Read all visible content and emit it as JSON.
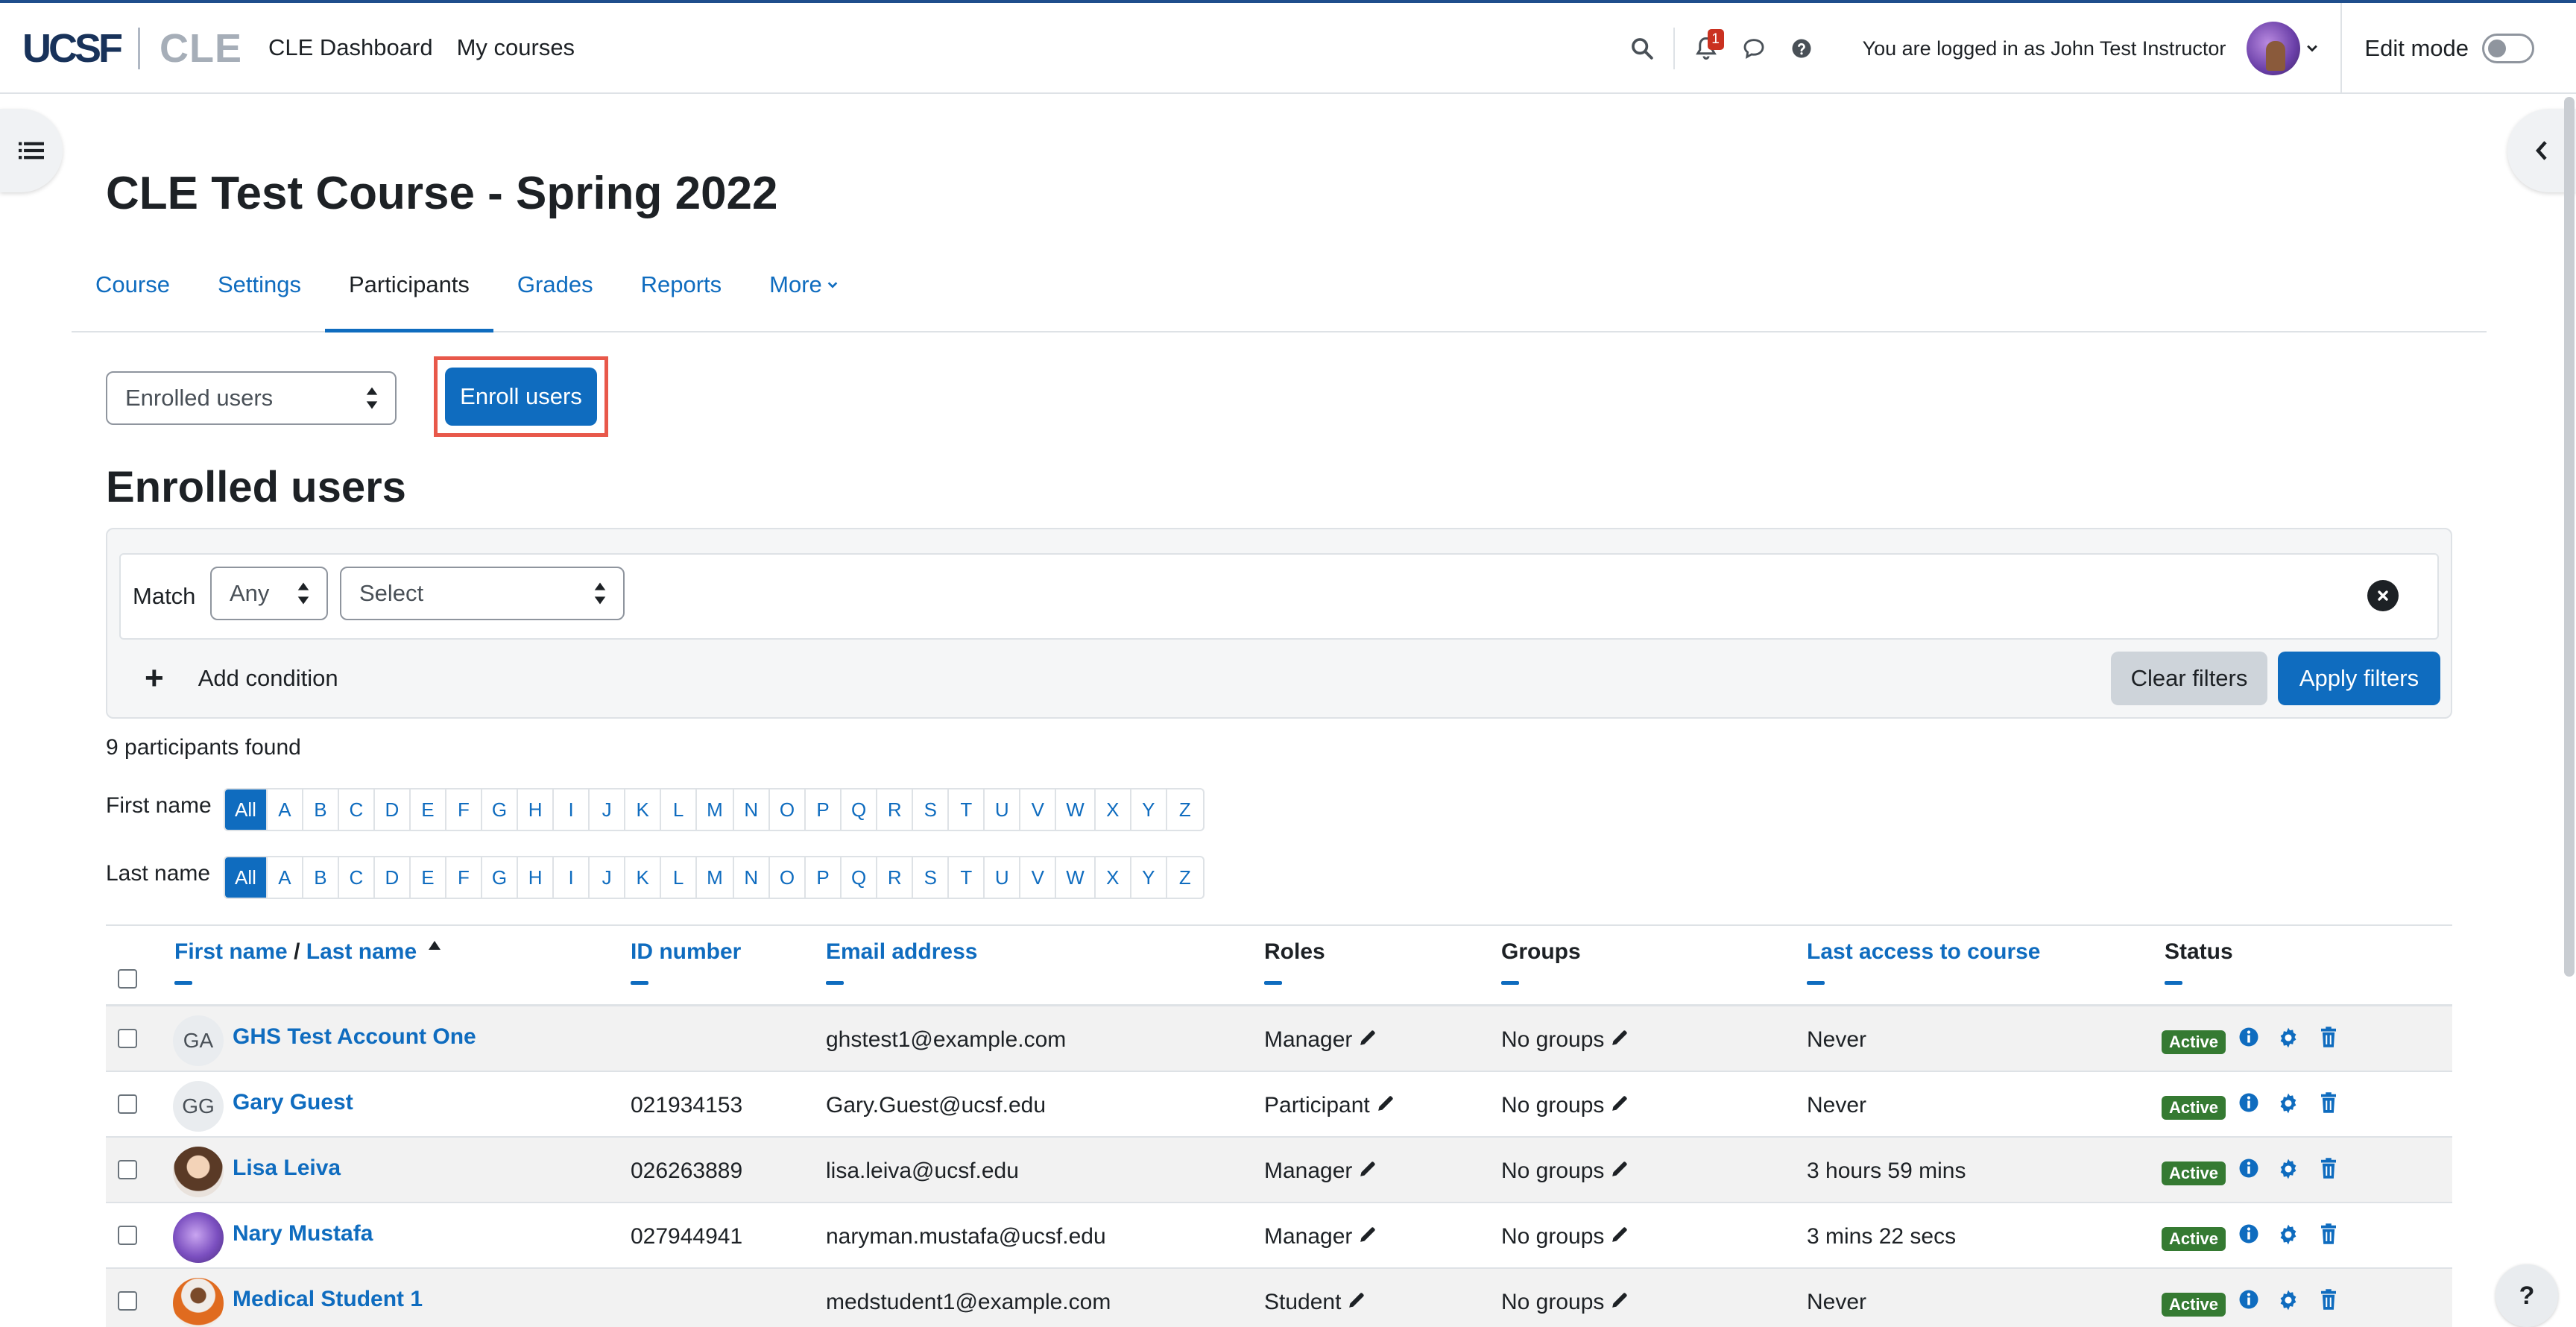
{
  "brand": {
    "logo_primary": "UCSF",
    "logo_secondary": "CLE"
  },
  "nav": {
    "links": [
      "CLE Dashboard",
      "My courses"
    ]
  },
  "header": {
    "notification_count": "1",
    "logged_in_text": "You are logged in as John Test Instructor",
    "edit_mode_label": "Edit mode"
  },
  "course": {
    "title": "CLE Test Course - Spring 2022",
    "tabs": [
      "Course",
      "Settings",
      "Participants",
      "Grades",
      "Reports",
      "More"
    ],
    "active_tab": "Participants"
  },
  "actions": {
    "view_select_value": "Enrolled users",
    "enroll_button": "Enroll users"
  },
  "section_title": "Enrolled users",
  "filters": {
    "match_label": "Match",
    "match_value": "Any",
    "select_value": "Select",
    "add_condition": "Add condition",
    "clear_button": "Clear filters",
    "apply_button": "Apply filters"
  },
  "participants_count_text": "9 participants found",
  "initials": {
    "first_label": "First name",
    "last_label": "Last name",
    "letters": [
      "All",
      "A",
      "B",
      "C",
      "D",
      "E",
      "F",
      "G",
      "H",
      "I",
      "J",
      "K",
      "L",
      "M",
      "N",
      "O",
      "P",
      "Q",
      "R",
      "S",
      "T",
      "U",
      "V",
      "W",
      "X",
      "Y",
      "Z"
    ]
  },
  "table": {
    "headers": {
      "first_name": "First name",
      "slash": "/",
      "last_name": "Last name",
      "id_number": "ID number",
      "email": "Email address",
      "roles": "Roles",
      "groups": "Groups",
      "last_access": "Last access to course",
      "status": "Status"
    },
    "rows": [
      {
        "initials": "GA",
        "name": "GHS Test Account One",
        "id": "",
        "email": "ghstest1@example.com",
        "role": "Manager",
        "groups": "No groups",
        "last_access": "Never",
        "status": "Active"
      },
      {
        "initials": "GG",
        "name": "Gary Guest",
        "id": "021934153",
        "email": "Gary.Guest@ucsf.edu",
        "role": "Participant",
        "groups": "No groups",
        "last_access": "Never",
        "status": "Active"
      },
      {
        "initials": "",
        "name": "Lisa Leiva",
        "id": "026263889",
        "email": "lisa.leiva@ucsf.edu",
        "role": "Manager",
        "groups": "No groups",
        "last_access": "3 hours 59 mins",
        "status": "Active"
      },
      {
        "initials": "",
        "name": "Nary Mustafa",
        "id": "027944941",
        "email": "naryman.mustafa@ucsf.edu",
        "role": "Manager",
        "groups": "No groups",
        "last_access": "3 mins 22 secs",
        "status": "Active"
      },
      {
        "initials": "",
        "name": "Medical Student 1",
        "id": "",
        "email": "medstudent1@example.com",
        "role": "Student",
        "groups": "No groups",
        "last_access": "Never",
        "status": "Active"
      }
    ]
  },
  "help_button": "?",
  "colors": {
    "primary": "#0f6cbf",
    "active_badge": "#357a32",
    "highlight": "#e8584a",
    "notification": "#ca3120"
  }
}
